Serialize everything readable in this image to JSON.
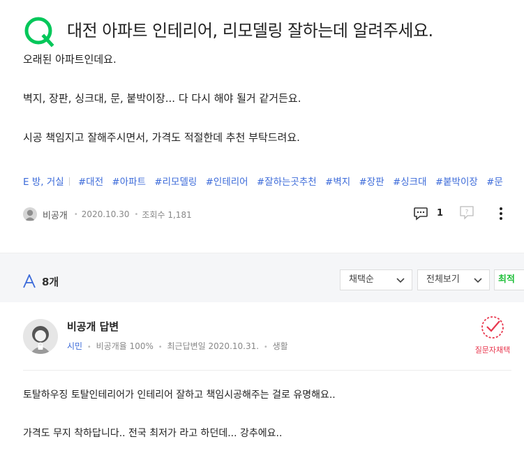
{
  "question": {
    "title": "대전 아파트 인테리어, 리모델링 잘하는데 알려주세요.",
    "lines": [
      "오래된 아파트인데요.",
      "벽지, 장판, 싱크대, 문, 붙박이장...   다 다시 해야 될거 같거든요.",
      "시공 책임지고 잘해주시면서, 가격도 적절한데 추천 부탁드려요."
    ],
    "category": "E 방, 거실",
    "tags": [
      "#대전",
      "#아파트",
      "#리모델링",
      "#인테리어",
      "#잘하는곳추천",
      "#벽지",
      "#장판",
      "#싱크대",
      "#붙박이장",
      "#문"
    ],
    "author": "비공개",
    "date": "2020.10.30",
    "views": "조회수 1,181",
    "comment_count": "1"
  },
  "answers_header": {
    "count": "8개",
    "sort_label": "채택순",
    "filter_label": "전체보기",
    "latest_label": "최적"
  },
  "answer": {
    "name": "비공개 답변",
    "grade": "시민",
    "adoption": "비공개율 100%",
    "recent": "최근답변일 2020.10.31.",
    "category": "생활",
    "chosen_label": "질문자채택",
    "lines": [
      "토탈하우징 토탈인테리어가 인테리어 잘하고 책임시공해주는 걸로 유명해요..",
      "가격도 무지 착하답니다.. 전국 최저가 라고 하던데... 강추에요.."
    ]
  },
  "colors": {
    "brand_green": "#03c75a",
    "tag_blue": "#3b6ad9",
    "chosen_red": "#e8384f"
  },
  "icons": [
    "q-logo-icon",
    "comment-icon",
    "report-icon",
    "more-icon",
    "answer-a-icon",
    "chevron-down-icon",
    "check-badge-icon",
    "avatar-icon"
  ]
}
